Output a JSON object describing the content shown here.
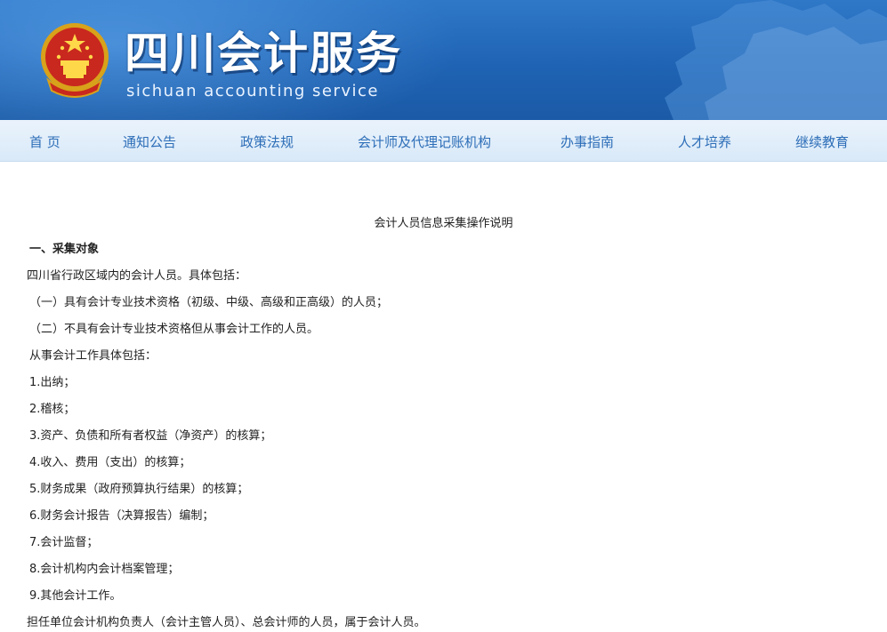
{
  "header": {
    "title_cn": "四川会计服务",
    "title_en": "sichuan accounting service",
    "emblem_icon": "national-emblem-icon",
    "colors": {
      "banner": "#1f63b4",
      "nav_text": "#2d6eb8",
      "nav_bg": "#dceaf8"
    }
  },
  "nav": {
    "items": [
      {
        "label": "首 页"
      },
      {
        "label": "通知公告"
      },
      {
        "label": "政策法规"
      },
      {
        "label": "会计师及代理记账机构"
      },
      {
        "label": "办事指南"
      },
      {
        "label": "人才培养"
      },
      {
        "label": "继续教育"
      }
    ]
  },
  "doc": {
    "title": "会计人员信息采集操作说明",
    "section1": "一、采集对象",
    "lines": [
      "四川省行政区域内的会计人员。具体包括：",
      "（一）具有会计专业技术资格（初级、中级、高级和正高级）的人员；",
      "（二）不具有会计专业技术资格但从事会计工作的人员。",
      "从事会计工作具体包括：",
      "1.出纳；",
      "2.稽核；",
      "3.资产、负债和所有者权益（净资产）的核算；",
      "4.收入、费用（支出）的核算；",
      "5.财务成果（政府预算执行结果）的核算；",
      "6.财务会计报告（决算报告）编制；",
      "7.会计监督；",
      "8.会计机构内会计档案管理；",
      "9.其他会计工作。",
      "担任单位会计机构负责人（会计主管人员）、总会计师的人员，属于会计人员。"
    ]
  }
}
